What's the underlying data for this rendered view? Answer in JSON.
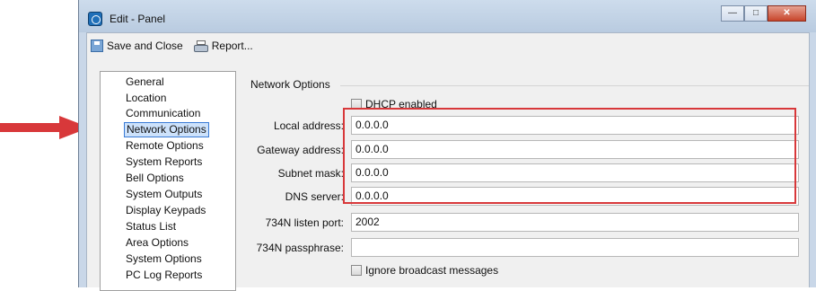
{
  "window": {
    "title": "Edit - Panel"
  },
  "toolbar": {
    "save_label": "Save and Close",
    "report_label": "Report..."
  },
  "nav": {
    "items": [
      "General",
      "Location",
      "Communication",
      "Network Options",
      "Remote Options",
      "System Reports",
      "Bell Options",
      "System Outputs",
      "Display Keypads",
      "Status List",
      "Area Options",
      "System Options",
      "PC Log Reports"
    ],
    "selected_index": 3
  },
  "network": {
    "group_title": "Network Options",
    "dhcp_label": "DHCP enabled",
    "local_address_label": "Local address:",
    "local_address_value": "0.0.0.0",
    "gateway_label": "Gateway address:",
    "gateway_value": "0.0.0.0",
    "subnet_label": "Subnet mask:",
    "subnet_value": "0.0.0.0",
    "dns_label": "DNS server:",
    "dns_value": "0.0.0.0",
    "listen_port_label": "734N listen port:",
    "listen_port_value": "2002",
    "passphrase_label": "734N passphrase:",
    "passphrase_value": "",
    "ignore_broadcast_label": "Ignore broadcast messages"
  },
  "colors": {
    "annotation_red": "#d8383a",
    "selection_blue": "#3a7bd5"
  }
}
